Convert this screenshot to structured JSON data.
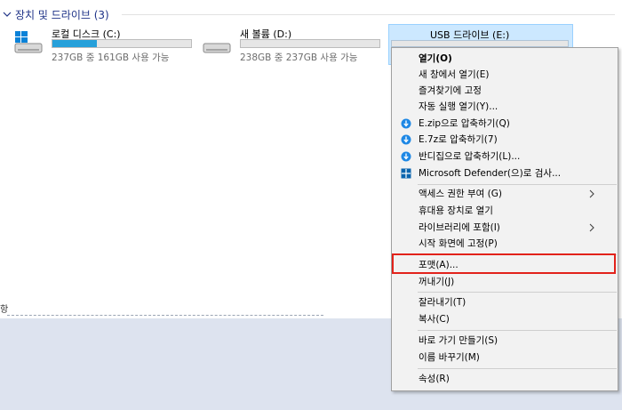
{
  "section": {
    "title": "장치 및 드라이브 (3)"
  },
  "drives": [
    {
      "name": "로컬 디스크 (C:)",
      "info": "237GB 중 161GB 사용 가능",
      "used_fraction": 0.32,
      "icon": "windows-drive-icon"
    },
    {
      "name": "새 볼륨 (D:)",
      "info": "238GB 중 237GB 사용 가능",
      "used_fraction": 0.0,
      "icon": "hard-drive-icon"
    },
    {
      "name": "USB 드라이브 (E:)",
      "icon": "usb-drive-icon"
    }
  ],
  "status": {
    "fragment": "항"
  },
  "context_menu": {
    "open": "열기(O)",
    "open_new_window": "새 창에서 열기(E)",
    "pin_quick_access": "즐겨찾기에 고정",
    "autoplay": "자동 실행 열기(Y)...",
    "compress_zip": "E.zip으로 압축하기(Q)",
    "compress_7z": "E.7z로 압축하기(7)",
    "compress_bandizip": "반디집으로 압축하기(L)...",
    "defender_scan": "Microsoft Defender(으)로 검사...",
    "give_access": "액세스 권한 부여 (G)",
    "open_portable": "휴대용 장치로 열기",
    "include_library": "라이브러리에 포함(I)",
    "pin_start": "시작 화면에 고정(P)",
    "format": "포맷(A)...",
    "eject": "꺼내기(J)",
    "cut": "잘라내기(T)",
    "copy": "복사(C)",
    "create_shortcut": "바로 가기 만들기(S)",
    "rename": "이름 바꾸기(M)",
    "properties": "속성(R)"
  },
  "colors": {
    "accent": "#26a0da",
    "highlight_border": "#e2221b",
    "selection": "#cce8ff",
    "bandizip_blue": "#1e88e5",
    "defender_blue": "#0a64ad"
  }
}
